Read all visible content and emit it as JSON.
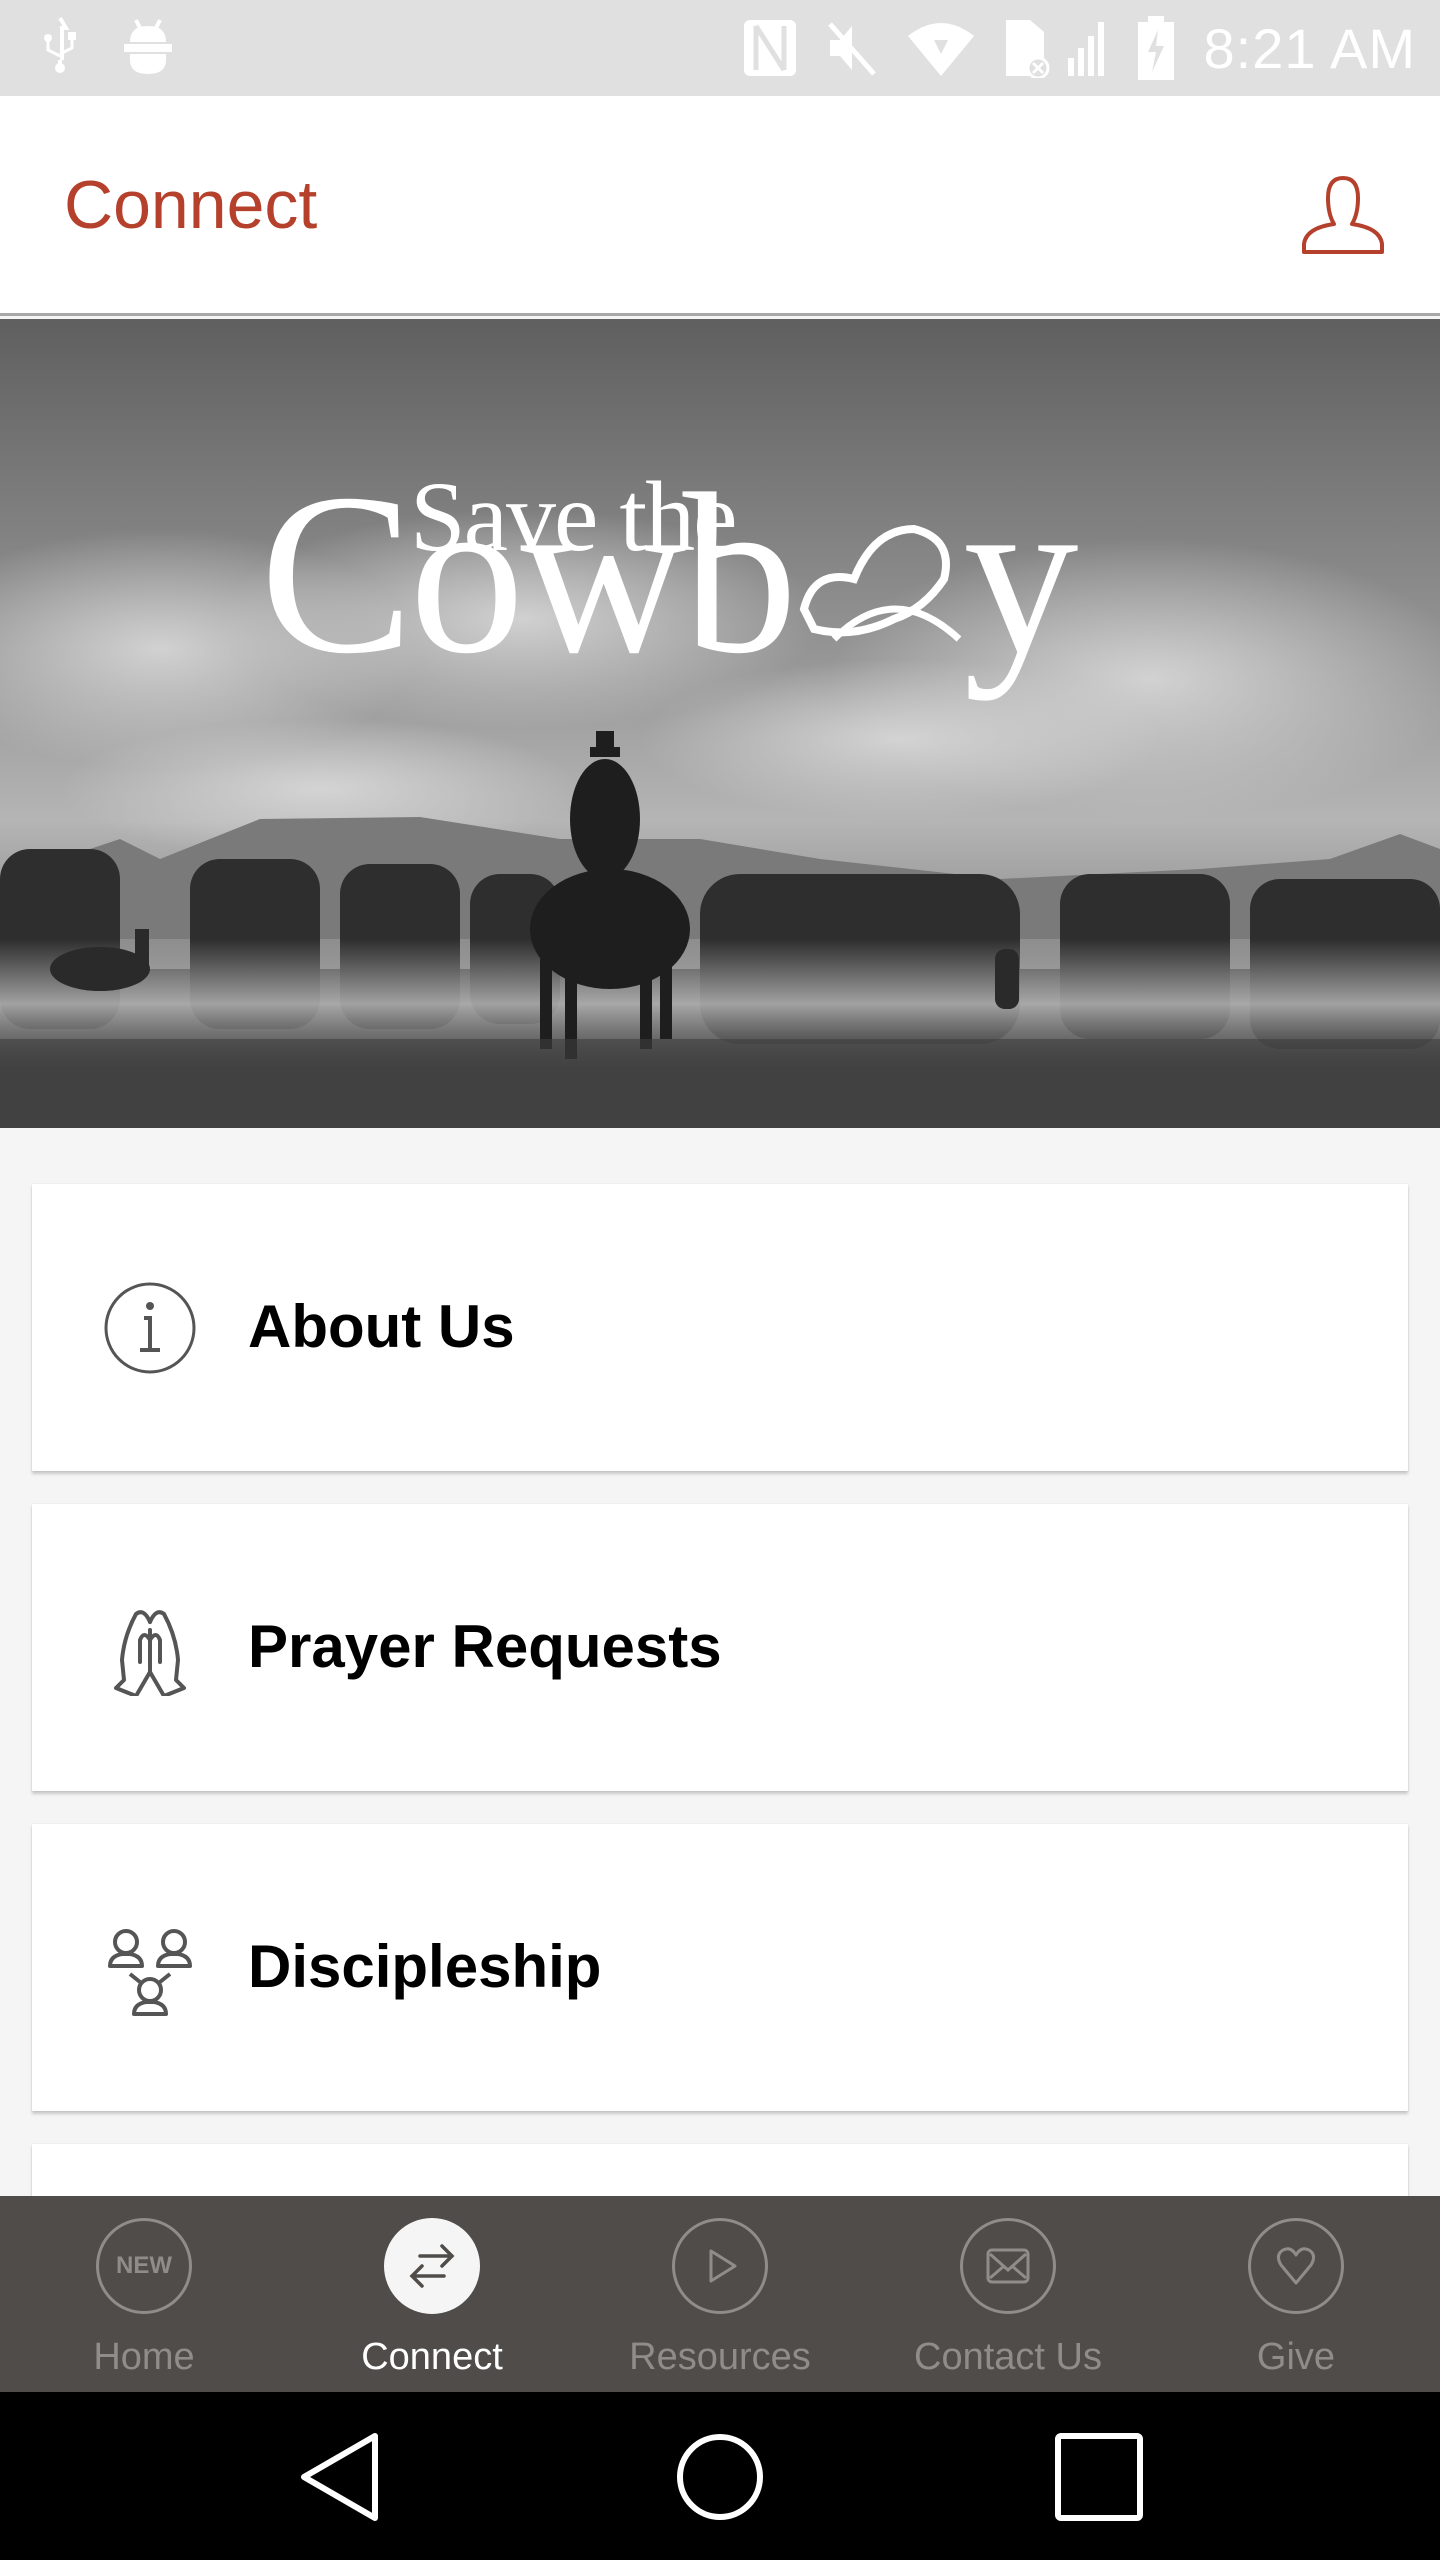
{
  "status_bar": {
    "left_icons": [
      "usb-icon",
      "android-debug-icon"
    ],
    "right_icons": [
      "nfc-icon",
      "mute-icon",
      "wifi-icon",
      "no-sim-icon",
      "signal-icon",
      "battery-charging-icon"
    ],
    "time": "8:21 AM"
  },
  "app_bar": {
    "title": "Connect",
    "profile_icon": "user-profile-icon",
    "accent_color": "#b5412c"
  },
  "hero": {
    "logo_line1": "Save the",
    "logo_line2": "Cowb",
    "logo_line2_end": "y",
    "logo_alt": "Save the Cowboy",
    "image_description": "Black and white photo of a cowboy on horseback herding horses with dogs in the dust"
  },
  "menu": {
    "items": [
      {
        "label": "About Us",
        "icon": "info-icon"
      },
      {
        "label": "Prayer Requests",
        "icon": "praying-hands-icon"
      },
      {
        "label": "Discipleship",
        "icon": "discipleship-group-icon"
      },
      {
        "label": "",
        "icon": ""
      }
    ]
  },
  "tab_bar": {
    "tabs": [
      {
        "label": "Home",
        "icon": "new-badge-icon",
        "icon_text": "NEW",
        "active": false
      },
      {
        "label": "Connect",
        "icon": "swap-arrows-icon",
        "active": true
      },
      {
        "label": "Resources",
        "icon": "play-icon",
        "active": false
      },
      {
        "label": "Contact Us",
        "icon": "envelope-icon",
        "active": false
      },
      {
        "label": "Give",
        "icon": "heart-icon",
        "active": false
      }
    ],
    "background": "#4f4c49"
  },
  "nav_bar": {
    "buttons": [
      "back-icon",
      "home-icon",
      "recents-icon"
    ]
  }
}
